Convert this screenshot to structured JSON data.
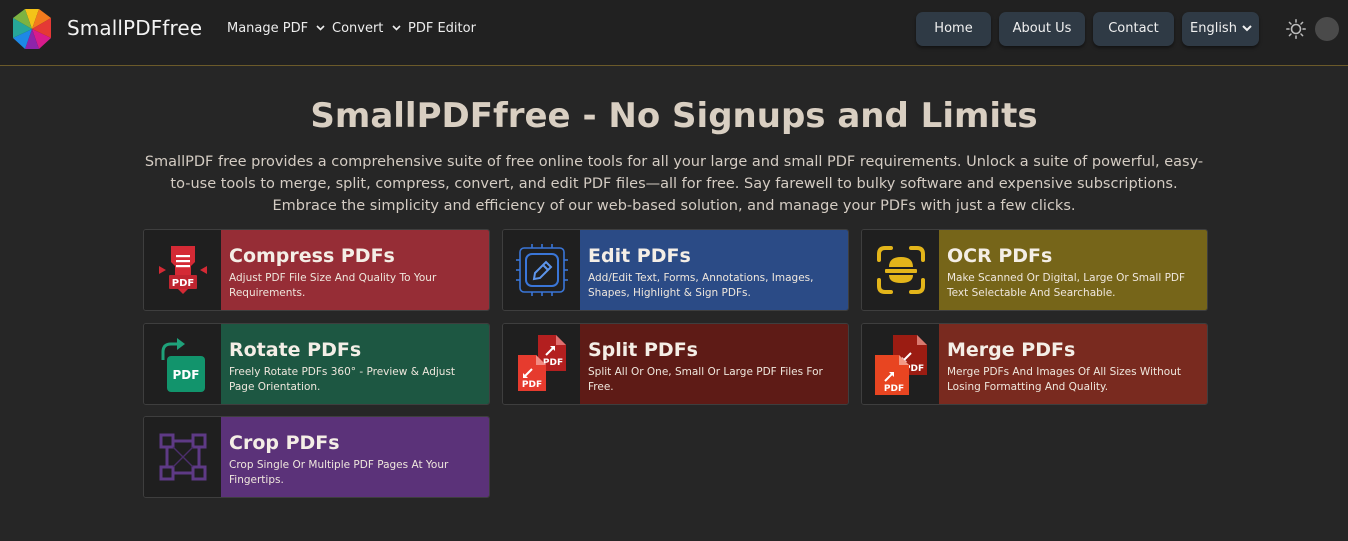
{
  "header": {
    "brand": "SmallPDFfree",
    "nav": [
      {
        "label": "Manage PDF"
      },
      {
        "label": "Convert"
      },
      {
        "label": "PDF Editor"
      }
    ],
    "buttons": [
      {
        "label": "Home"
      },
      {
        "label": "About Us"
      },
      {
        "label": "Contact"
      }
    ],
    "language": "English"
  },
  "hero": {
    "title": "SmallPDFfree - No Signups and Limits",
    "description": "SmallPDF free provides a comprehensive suite of free online tools for all your large and small PDF requirements. Unlock a suite of powerful, easy-to-use tools to merge, split, compress, convert, and edit PDF files—all for free. Say farewell to bulky software and expensive subscriptions. Embrace the simplicity and efficiency of our web-based solution, and manage your PDFs with just a few clicks."
  },
  "tools": [
    {
      "title": "Compress PDFs",
      "text": "Adjust PDF File Size And Quality To Your Requirements.",
      "color": "#962d36",
      "icon": "compress-icon"
    },
    {
      "title": "Edit PDFs",
      "text": "Add/Edit Text, Forms, Annotations, Images, Shapes, Highlight & Sign PDFs.",
      "color": "#2b4b86",
      "icon": "edit-icon"
    },
    {
      "title": "OCR PDFs",
      "text": "Make Scanned Or Digital, Large Or Small PDF Text Selectable And Searchable.",
      "color": "#766519",
      "icon": "ocr-icon"
    },
    {
      "title": "Rotate PDFs",
      "text": "Freely Rotate PDFs 360° - Preview & Adjust Page Orientation.",
      "color": "#1d5742",
      "icon": "rotate-icon"
    },
    {
      "title": "Split PDFs",
      "text": "Split All Or One, Small Or Large PDF Files For Free.",
      "color": "#5e1b16",
      "icon": "split-icon"
    },
    {
      "title": "Merge PDFs",
      "text": "Merge PDFs And Images Of All Sizes Without Losing Formatting And Quality.",
      "color": "#792a1f",
      "icon": "merge-icon"
    },
    {
      "title": "Crop PDFs",
      "text": "Crop Single Or Multiple PDF Pages At Your Fingertips.",
      "color": "#5b3279",
      "icon": "crop-icon"
    }
  ],
  "icon_labels": {
    "pdf": "PDF"
  }
}
